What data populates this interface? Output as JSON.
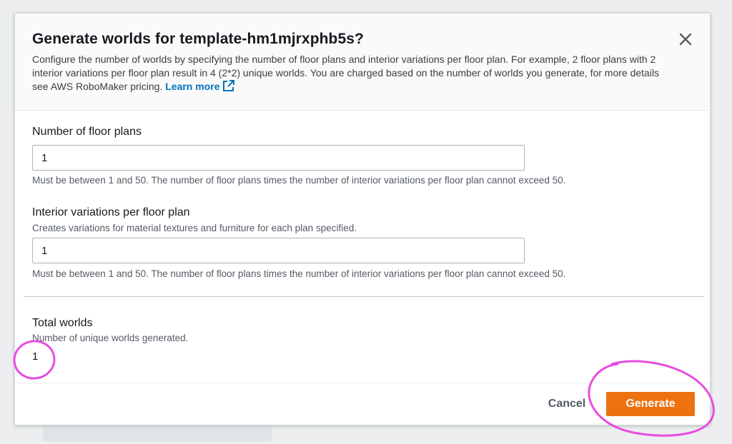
{
  "dialog": {
    "title": "Generate worlds for template-hm1mjrxphb5s?",
    "description": "Configure the number of worlds by specifying the number of floor plans and interior variations per floor plan. For example, 2 floor plans with 2 interior variations per floor plan result in 4 (2*2) unique worlds. You are charged based on the number of worlds you generate, for more details see AWS RoboMaker pricing.",
    "learn_more_label": "Learn more",
    "close_icon": "close-icon"
  },
  "floor_plans": {
    "label": "Number of floor plans",
    "value": "1",
    "constraint": "Must be between 1 and 50. The number of floor plans times the number of interior variations per floor plan cannot exceed 50."
  },
  "interior_variations": {
    "label": "Interior variations per floor plan",
    "description": "Creates variations for material textures and furniture for each plan specified.",
    "value": "1",
    "constraint": "Must be between 1 and 50. The number of floor plans times the number of interior variations per floor plan cannot exceed 50."
  },
  "total_worlds": {
    "label": "Total worlds",
    "description": "Number of unique worlds generated.",
    "value": "1"
  },
  "footer": {
    "cancel_label": "Cancel",
    "generate_label": "Generate"
  },
  "colors": {
    "primary_button": "#ec7211",
    "link": "#0073bb",
    "annotation": "#e84ce0"
  }
}
